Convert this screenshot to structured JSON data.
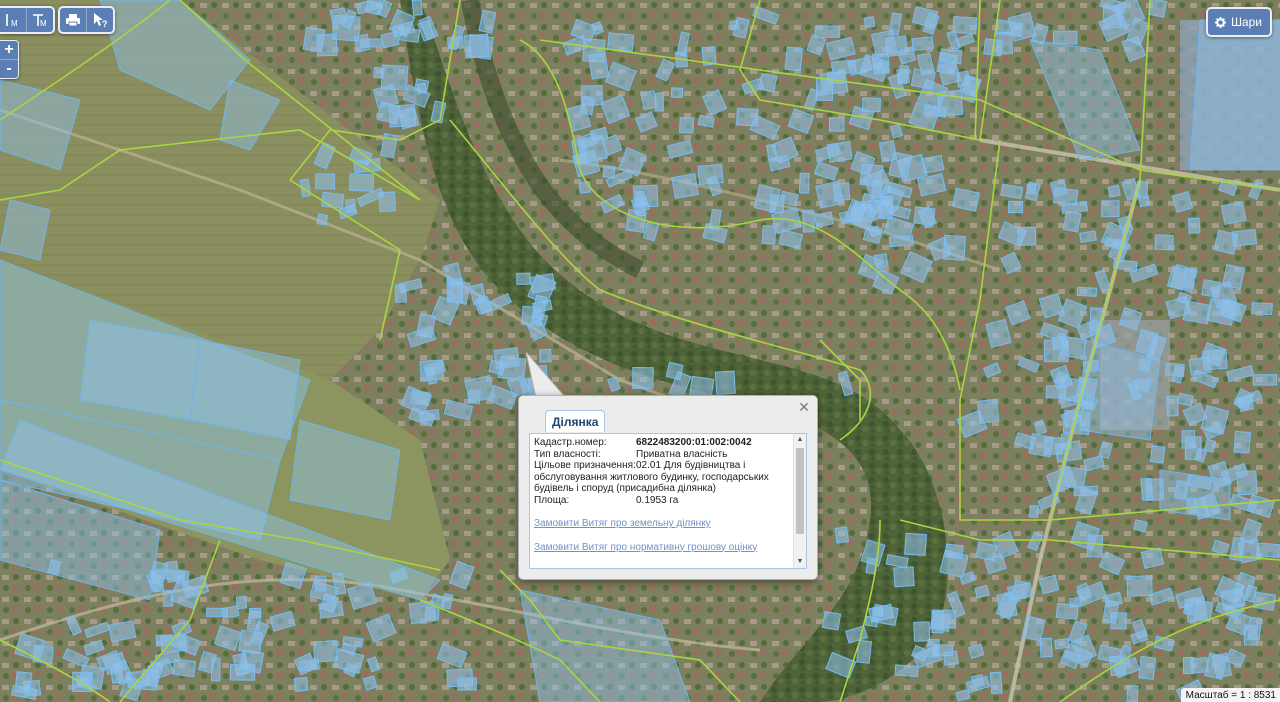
{
  "toolbar": {
    "tools": [
      {
        "icon": "measure-distance-icon",
        "label": "M"
      },
      {
        "icon": "measure-area-icon",
        "label": "M"
      },
      {
        "icon": "print-icon"
      },
      {
        "icon": "identify-icon",
        "label": "?"
      }
    ],
    "layers_button": {
      "label": "Шари",
      "icon": "gear-icon"
    }
  },
  "zoom": {
    "in_label": "+",
    "out_label": "-"
  },
  "popup": {
    "tab_label": "Ділянка",
    "close_label": "✕",
    "fields": {
      "cadastral_label": "Кадастр.номер:",
      "cadastral_value": "6822483200:01:002:0042",
      "ownership_label": "Тип власності:",
      "ownership_value": "Приватна власність",
      "purpose_label": "Цільове призначення:",
      "purpose_value_first": "02.01 Для будівництва і",
      "purpose_value_rest": "обслуговування житлового будинку, господарських будівель і споруд (присадибна ділянка)",
      "area_label": "Площа:",
      "area_value": "0.1953 га"
    },
    "links": {
      "land_extract": "Замовити Витяг про земельну ділянку",
      "valuation_extract": "Замовити Витяг про нормативну грошову оцінку"
    }
  },
  "scale": {
    "text": "Масштаб = 1 : 8531"
  },
  "colors": {
    "parcel_fill": "#8fc3ee",
    "parcel_stroke": "#6fb4ec",
    "boundary": "#a8d640",
    "button_bg": "#5b7fb4",
    "link": "#6f93c4"
  }
}
